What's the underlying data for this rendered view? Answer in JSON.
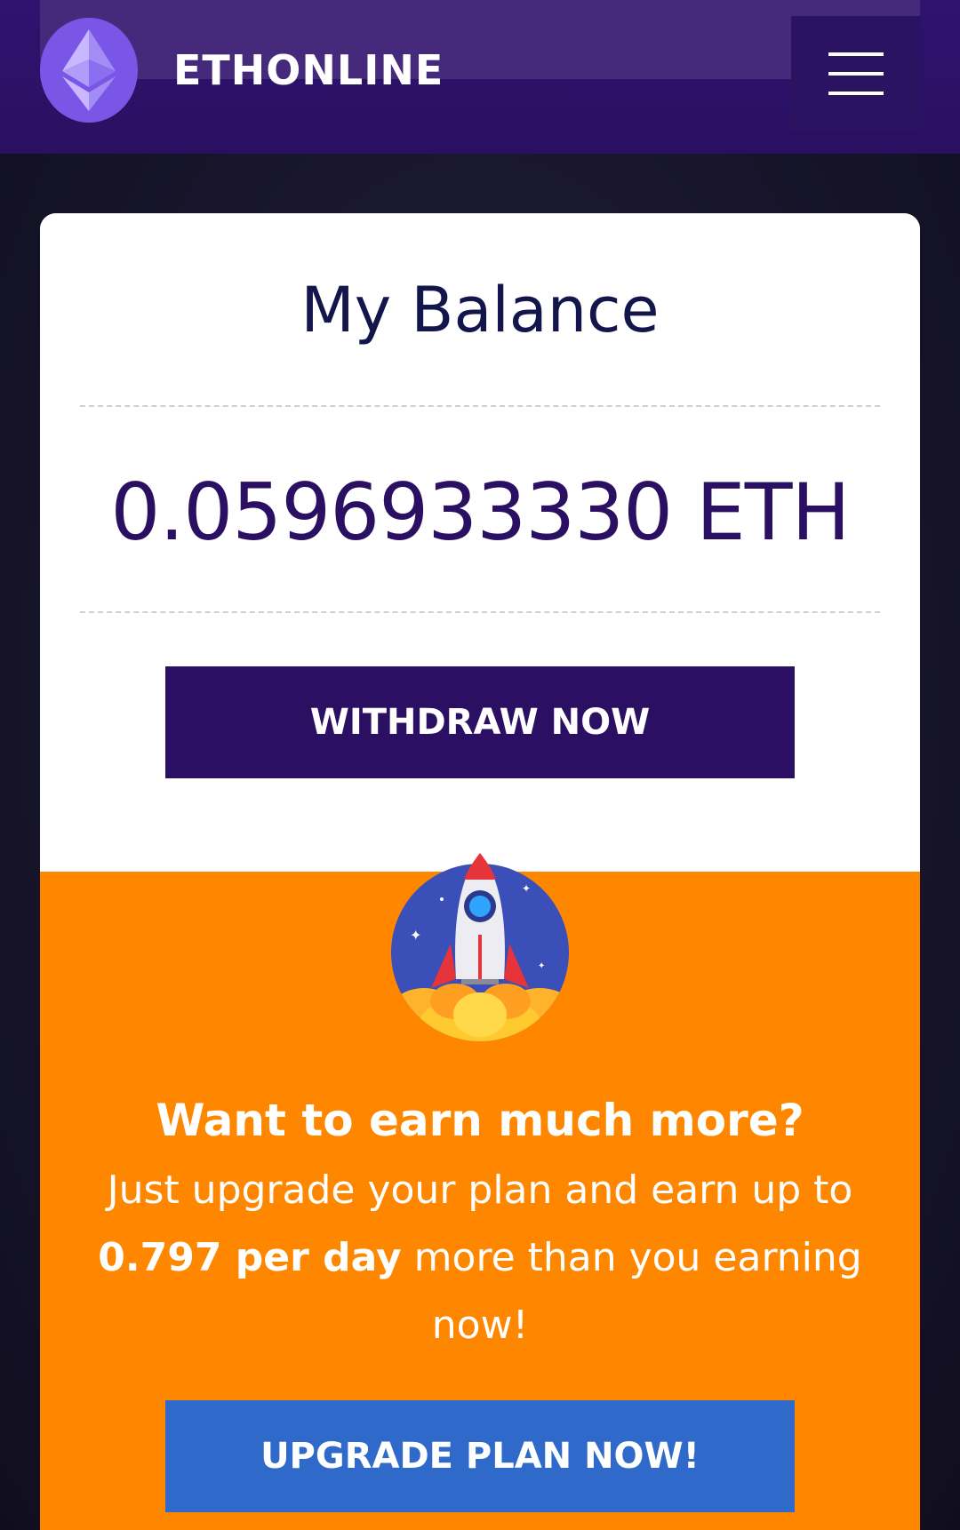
{
  "header": {
    "brand": "ETHONLINE",
    "logo_icon": "ethereum-logo-icon",
    "menu_icon": "hamburger-menu-icon"
  },
  "balance": {
    "title": "My Balance",
    "amount": "0.0596933330 ETH",
    "withdraw_label": "WITHDRAW NOW"
  },
  "upsell": {
    "illustration": "rocket-launch-icon",
    "heading": "Want to earn much more?",
    "text_before": "Just upgrade your plan and earn up to ",
    "highlight": "0.797 per day",
    "text_after": " more than you earning now!",
    "upgrade_label": "UPGRADE PLAN NOW!"
  },
  "colors": {
    "header_bg": "#2a1061",
    "accent_purple": "#2a0f62",
    "upsell_orange": "#ff8700",
    "upgrade_blue": "#2f6acb",
    "logo_purple": "#7a56e6"
  }
}
